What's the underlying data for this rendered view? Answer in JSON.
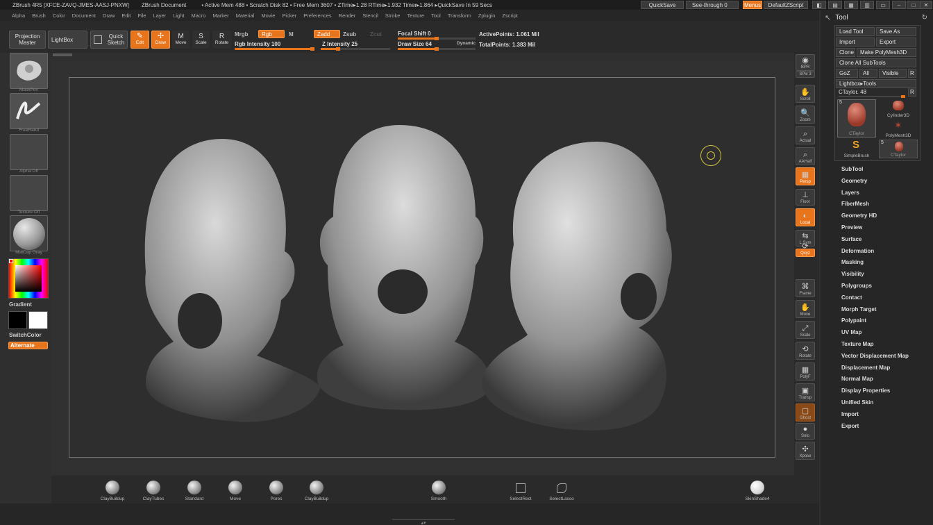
{
  "titlebar": {
    "app": "ZBrush 4R5 [XFCE-ZAVQ-JMES-AASJ-PNXW]",
    "doc": "ZBrush Document",
    "stats": "• Active Mem 488 • Scratch Disk 82 • Free Mem 3607 • ZTime▸1.28 RTime▸1.932 Timer▸1.864 ▸QuickSave In 59 Secs",
    "quicksave": "QuickSave",
    "seethrough": "See-through 0",
    "menus": "Menus",
    "script": "DefaultZScript"
  },
  "menus": [
    "Alpha",
    "Brush",
    "Color",
    "Document",
    "Draw",
    "Edit",
    "File",
    "Layer",
    "Light",
    "Macro",
    "Marker",
    "Material",
    "Movie",
    "Picker",
    "Preferences",
    "Render",
    "Stencil",
    "Stroke",
    "Texture",
    "Tool",
    "Transform",
    "Zplugin",
    "Zscript"
  ],
  "shelf": {
    "projection_master": "Projection Master",
    "lightbox": "LightBox",
    "quick_sketch": "Quick Sketch",
    "edit": "Edit",
    "draw": "Draw",
    "move": "Move",
    "scale": "Scale",
    "rotate": "Rotate",
    "mrgb": "Mrgb",
    "rgb": "Rgb",
    "m": "M",
    "rgb_intensity": "Rgb Intensity 100",
    "zadd": "Zadd",
    "zsub": "Zsub",
    "zcut": "Zcut",
    "z_intensity": "Z Intensity 25",
    "focal_shift": "Focal Shift 0",
    "draw_size": "Draw Size 64",
    "dynamic": "Dynamic",
    "active_points": "ActivePoints: 1.061 Mil",
    "total_points": "TotalPoints: 1.383 Mil",
    "rgb_intensity_value": 100,
    "z_intensity_value": 25,
    "focal_shift_value": 0,
    "draw_size_value": 64
  },
  "left": {
    "brush_cap": "MaskPen",
    "stroke_cap": "FreeHand",
    "alpha_cap": "Alpha  Off",
    "texture_cap": "Texture  Off",
    "material_cap": "MatCap Gray",
    "gradient": "Gradient",
    "switchcolor": "SwitchColor",
    "alternate": "Alternate"
  },
  "right": [
    "BPR",
    "SPix 3",
    "Scroll",
    "Zoom",
    "Actual",
    "AAHalf",
    "Persp",
    "Floor",
    "Local",
    "L.Sym",
    "Qxyz",
    "Frame",
    "Move",
    "Scale",
    "Rotate",
    "PolyF",
    "Transp",
    "Ghost",
    "Solo",
    "Xpose"
  ],
  "tool": {
    "title": "Tool",
    "load_tool": "Load Tool",
    "save_as": "Save As",
    "import": "Import",
    "export": "Export",
    "clone": "Clone",
    "make_polymesh": "Make PolyMesh3D",
    "clone_all": "Clone All SubTools",
    "goz": "GoZ",
    "all": "All",
    "visible": "Visible",
    "r": "R",
    "lightbox_tools": "Lightbox▸Tools",
    "ctaylor": "CTaylor. 48",
    "thumbs": [
      "CTaylor",
      "Cylinder3D",
      "PolyMesh3D",
      "SimpleBrush",
      "CTaylor"
    ],
    "thumb_num": "5",
    "sections": [
      "SubTool",
      "Geometry",
      "Layers",
      "FiberMesh",
      "Geometry HD",
      "Preview",
      "Surface",
      "Deformation",
      "Masking",
      "Visibility",
      "Polygroups",
      "Contact",
      "Morph Target",
      "Polypaint",
      "UV Map",
      "Texture Map",
      "Vector Displacement Map",
      "Displacement Map",
      "Normal Map",
      "Display Properties",
      "Unified Skin",
      "Import",
      "Export"
    ]
  },
  "bottom": {
    "brushes": [
      "ClayBuildup",
      "ClayTubes",
      "Standard",
      "Move",
      "Pores",
      "ClayBuildup"
    ],
    "smooth": "Smooth",
    "select_rect": "SelectRect",
    "select_lasso": "SelectLasso",
    "material": "SkinShade4"
  },
  "colors": {
    "accent": "#e8741b",
    "primary": "#000000",
    "secondary": "#ffffff"
  }
}
